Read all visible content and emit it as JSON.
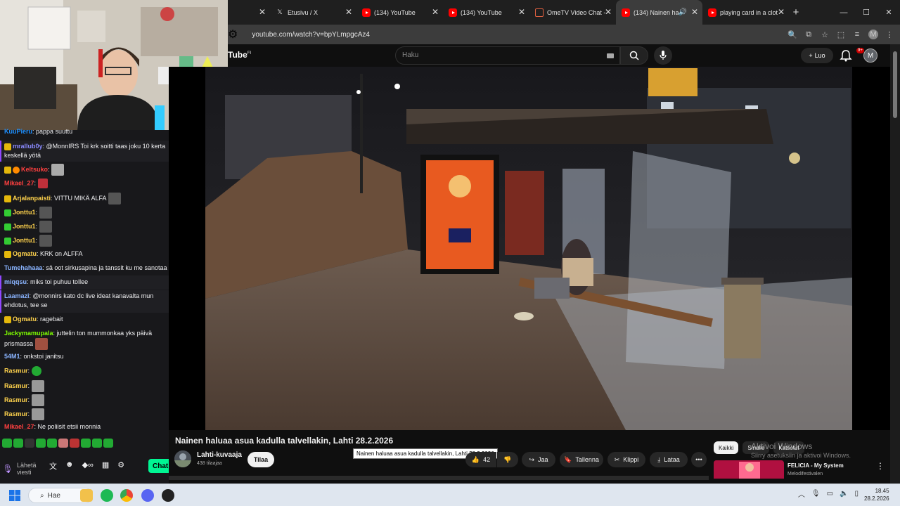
{
  "browser": {
    "tabs": [
      {
        "label": "",
        "active": false,
        "icon": "blank"
      },
      {
        "label": "Etusivu / X",
        "active": false,
        "icon": "x-logo"
      },
      {
        "label": "(134) YouTube",
        "active": false,
        "icon": "youtube"
      },
      {
        "label": "(134) YouTube",
        "active": false,
        "icon": "youtube"
      },
      {
        "label": "OmeTV Video Chat -",
        "active": false,
        "icon": "ometv"
      },
      {
        "label": "(134) Nainen halu",
        "active": true,
        "icon": "youtube"
      },
      {
        "label": "playing card in a clot",
        "active": false,
        "icon": "youtube"
      }
    ],
    "address": "youtube.com/watch?v=bpYLmpgcAz4",
    "profile_initial": "M"
  },
  "youtube": {
    "logo_text": "Tube",
    "logo_region": "FI",
    "search_placeholder": "Haku",
    "create_label": "Luo",
    "notif_count": "9+",
    "avatar_initial": "M",
    "video_title": "Nainen haluaa asua kadulla talvellakin, Lahti 28.2.2026",
    "tooltip": "Nainen haluaa asua kadulla talvellakin, Lahti 28.2.2026",
    "channel_name": "Lahti-kuvaaja",
    "subscribers": "438 tilaajaa",
    "subscribe_label": "Tilaa",
    "like_count": "42",
    "share_label": "Jaa",
    "save_label": "Tallenna",
    "clip_label": "Klippi",
    "download_label": "Lataa",
    "chips": [
      "Kaikki",
      "Sinulle",
      "Katsotut"
    ],
    "recommendation": {
      "title": "FELICIA - My System",
      "channel": "Melodifestivalen"
    }
  },
  "activation_watermark": {
    "title": "Aktivoi Windows",
    "subtitle": "Siirry asetuksiin ja aktivoi Windows."
  },
  "chat": {
    "messages": [
      {
        "name": "KuuPieru",
        "color": "#1e90ff",
        "text": "pappa suuttu"
      },
      {
        "name": "mrallub0y",
        "color": "#8a8aff",
        "text": "@MonnIRS Toi krk soitti taas joku 10 kerta keskellä yötä"
      },
      {
        "name": "Keltsuko",
        "color": "#ff4040",
        "text": ""
      },
      {
        "name": "Mikael_27",
        "color": "#ff4040",
        "text": ""
      },
      {
        "name": "Arjalanpaisti",
        "color": "#ffd34d",
        "text": "VITTU MIKÄ ALFA"
      },
      {
        "name": "Jonttu1",
        "color": "#ffd34d",
        "text": ""
      },
      {
        "name": "Jonttu1",
        "color": "#ffd34d",
        "text": ""
      },
      {
        "name": "Jonttu1",
        "color": "#ffd34d",
        "text": ""
      },
      {
        "name": "Ogmatu",
        "color": "#ffd34d",
        "text": "KRK on ALFFA"
      },
      {
        "name": "Tumehahaaa",
        "color": "#8ab4ff",
        "text": "sä oot sirkusapina ja tanssit ku me sanotaa"
      },
      {
        "name": "miqqsu",
        "color": "#8ab4ff",
        "text": "miks toi puhuu tollee"
      },
      {
        "name": "Laamazi",
        "color": "#8ab4ff",
        "text": "@monnirs kato dc live ideat kanavalta mun ehdotus, tee se"
      },
      {
        "name": "Ogmatu",
        "color": "#ffd34d",
        "text": "ragebait"
      },
      {
        "name": "Jackymamupala",
        "color": "#7fff00",
        "text": "juttelin ton mummonkaa yks päivä prismassa"
      },
      {
        "name": "54M1",
        "color": "#8ab4ff",
        "text": "onkstoi janitsu"
      },
      {
        "name": "Rasmur",
        "color": "#ffd34d",
        "text": ""
      },
      {
        "name": "Rasmur",
        "color": "#ffd34d",
        "text": ""
      },
      {
        "name": "Rasmur",
        "color": "#ffd34d",
        "text": ""
      },
      {
        "name": "Rasmur",
        "color": "#ffd34d",
        "text": ""
      },
      {
        "name": "Mikael_27",
        "color": "#ff4040",
        "text": "Ne poliisit etsii monnia"
      }
    ],
    "input_placeholder": "Lähetä viesti",
    "chat_button": "Chat"
  },
  "taskbar": {
    "search_label": "Hae",
    "time": "18.45",
    "date": "28.2.2026"
  }
}
